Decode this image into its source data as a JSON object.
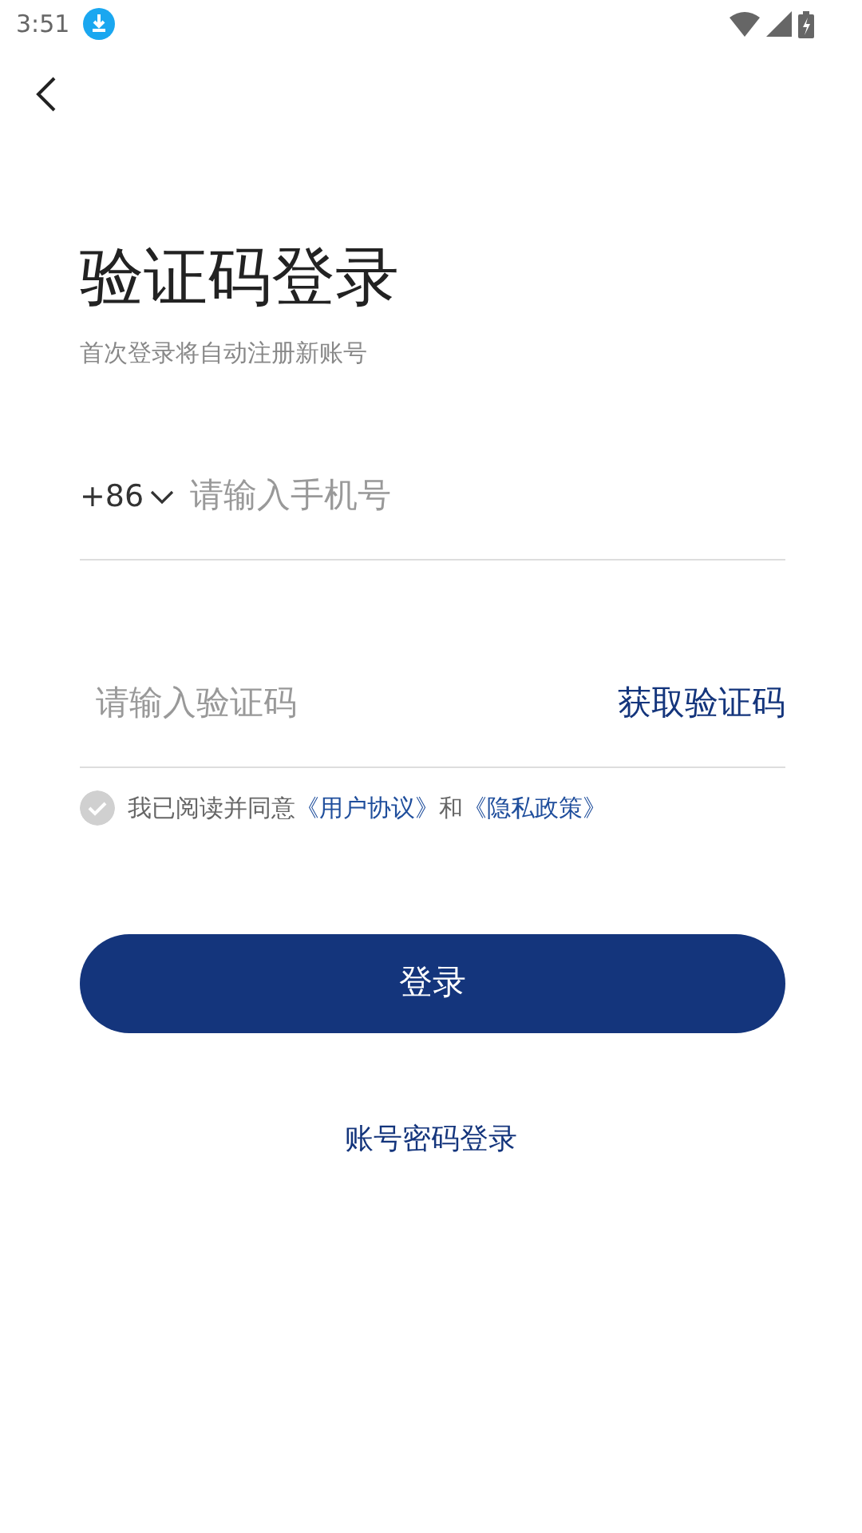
{
  "status_bar": {
    "time": "3:51"
  },
  "title": "验证码登录",
  "subtitle": "首次登录将自动注册新账号",
  "phone": {
    "country_code": "+86",
    "placeholder": "请输入手机号"
  },
  "code": {
    "placeholder": "请输入验证码",
    "get_code": "获取验证码"
  },
  "agreement": {
    "checked": false,
    "parts": [
      {
        "kind": "text",
        "text": "我已阅读并同意"
      },
      {
        "kind": "link",
        "text": "《用户协议》"
      },
      {
        "kind": "text",
        "text": "和"
      },
      {
        "kind": "link",
        "text": "《隐私政策》"
      }
    ]
  },
  "login_button": "登录",
  "password_login": "账号密码登录"
}
